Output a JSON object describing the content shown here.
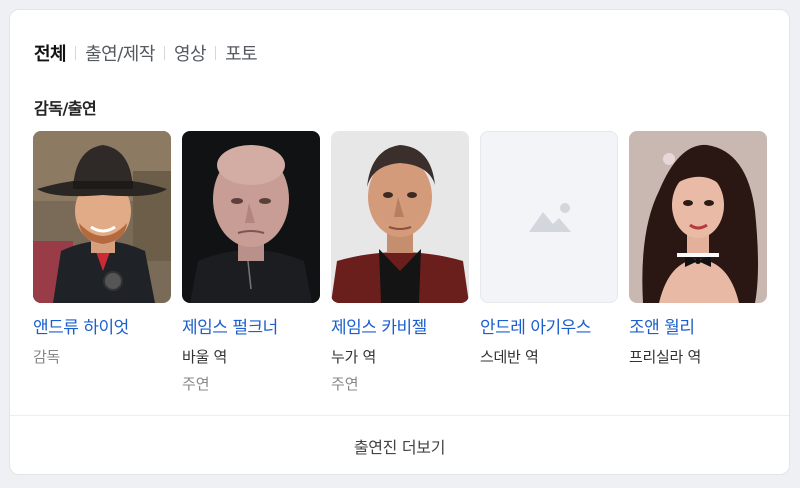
{
  "tabs": [
    {
      "label": "전체",
      "active": true
    },
    {
      "label": "출연/제작",
      "active": false
    },
    {
      "label": "영상",
      "active": false
    },
    {
      "label": "포토",
      "active": false
    }
  ],
  "section_title": "감독/출연",
  "people": [
    {
      "name": "앤드류 하이엇",
      "role": "감독",
      "sub": "",
      "photo": "cowboy-hat-man-photo"
    },
    {
      "name": "제임스 펄크너",
      "role": "바울 역",
      "sub": "주연",
      "photo": "bald-man-photo"
    },
    {
      "name": "제임스 카비젤",
      "role": "누가 역",
      "sub": "주연",
      "photo": "dark-haired-man-photo"
    },
    {
      "name": "안드레 아기우스",
      "role": "스데반 역",
      "sub": "",
      "photo": "image-placeholder-icon"
    },
    {
      "name": "조앤 월리",
      "role": "프리실라 역",
      "sub": "",
      "photo": "dark-haired-woman-photo"
    }
  ],
  "footer": {
    "more_label": "출연진 더보기"
  },
  "colors": {
    "link": "#1b5fcc",
    "placeholder_bg": "#f2f4f7",
    "placeholder_icon": "#d3d7dd"
  }
}
